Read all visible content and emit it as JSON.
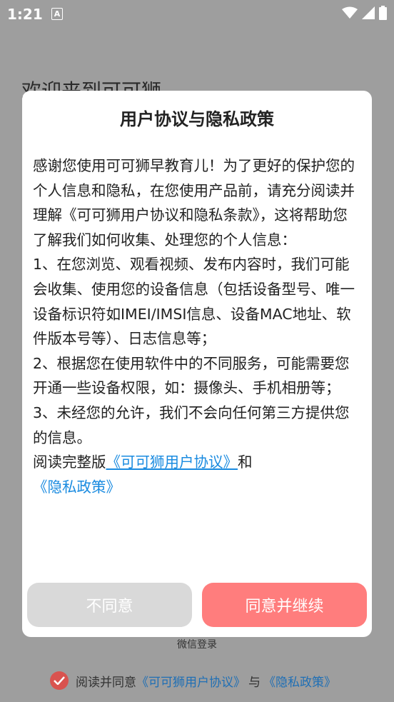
{
  "status_bar": {
    "time": "1:21",
    "a_label": "A",
    "icons": [
      "wifi-icon",
      "signal-icon",
      "battery-icon"
    ]
  },
  "background": {
    "heading": "欢迎来到可可狮",
    "wechat_login": "微信登录",
    "agreement": {
      "prefix": "阅读并同意",
      "user_agreement": "《可可狮用户协议》",
      "conjunction": "与",
      "privacy_policy": "《隐私政策》"
    }
  },
  "dialog": {
    "title": "用户协议与隐私政策",
    "paragraphs": [
      "感谢您使用可可狮早教育儿！为了更好的保护您的个人信息和隐私，在您使用产品前，请充分阅读并理解《可可狮用户协议和隐私条款》，这将帮助您了解我们如何收集、处理您的个人信息：",
      "1、在您浏览、观看视频、发布内容时，我们可能会收集、使用您的设备信息（包括设备型号、唯一设备标识符如IMEI/IMSI信息、设备MAC地址、软件版本号等）、日志信息等；",
      "2、根据您在使用软件中的不同服务，可能需要您开通一些设备权限，如：摄像头、手机相册等；",
      "3、未经您的允许，我们不会向任何第三方提供您的信息。"
    ],
    "read_full_prefix": "阅读完整版",
    "user_agreement_link": "《可可狮用户协议》",
    "and": "和",
    "privacy_link": "《隐私政策》",
    "disagree_label": "不同意",
    "agree_label": "同意并继续"
  },
  "colors": {
    "agree_button": "#ff7d7d",
    "disagree_button": "#d9d9d9",
    "link": "#1a8be0",
    "check": "#d9534f"
  }
}
